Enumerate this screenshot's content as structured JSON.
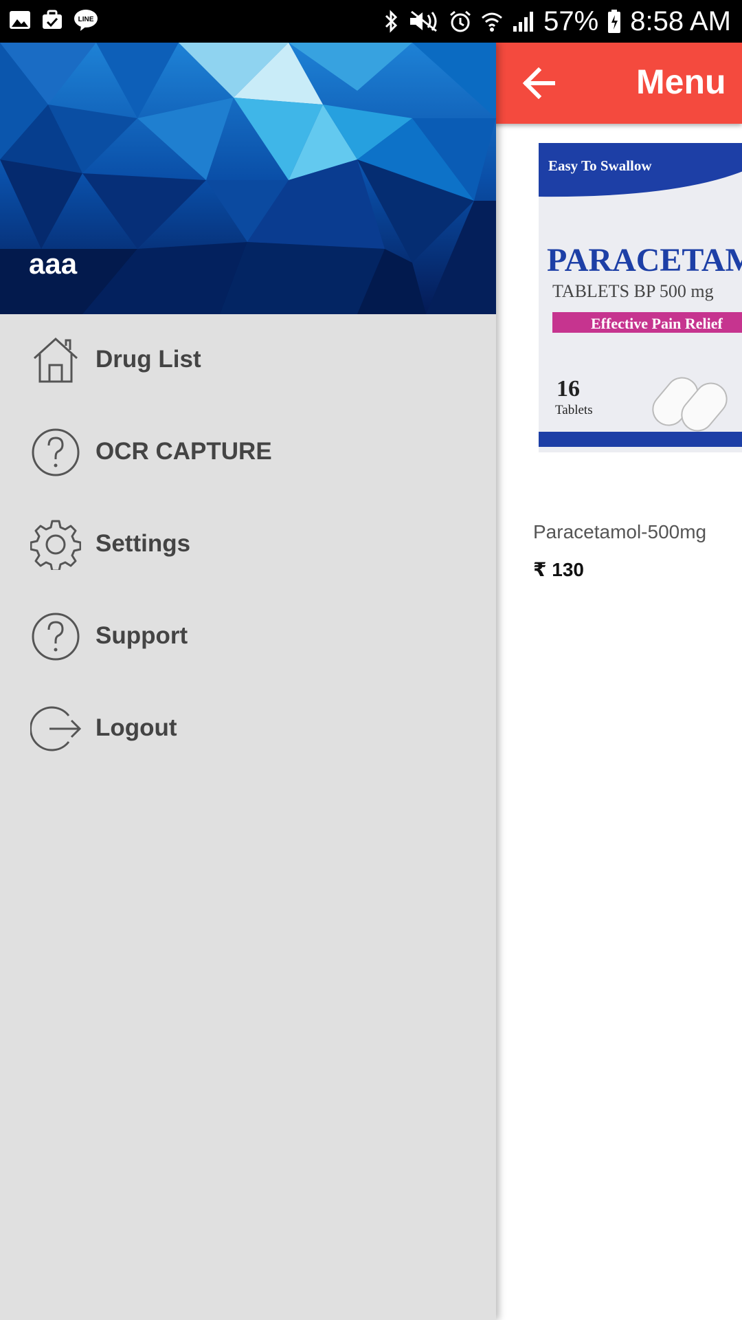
{
  "status_bar": {
    "battery": "57%",
    "time": "8:58 AM",
    "left_icons": [
      "image-icon",
      "briefcase-icon",
      "line-icon"
    ],
    "right_icons": [
      "bluetooth-icon",
      "mute-icon",
      "alarm-icon",
      "wifi-icon",
      "signal-icon",
      "battery-icon"
    ]
  },
  "app_bar": {
    "title": "Menu",
    "back_icon": "arrow-left-icon",
    "color": "#f44a3e"
  },
  "product": {
    "name": "Paracetamol-500mg",
    "price": "₹ 130",
    "image_texts": {
      "tagline": "Easy To Swallow",
      "brand": "PARACETAMO",
      "strength": "TABLETS BP 500 mg",
      "claim": "Effective Pain Relief",
      "count": "16",
      "count_unit": "Tablets"
    }
  },
  "drawer": {
    "user_name": "aaa",
    "items": [
      {
        "label": "Drug List",
        "icon": "home-icon"
      },
      {
        "label": "OCR CAPTURE",
        "icon": "help-circle-icon"
      },
      {
        "label": "Settings",
        "icon": "gear-icon"
      },
      {
        "label": "Support",
        "icon": "help-circle-icon"
      },
      {
        "label": "Logout",
        "icon": "logout-icon"
      }
    ]
  }
}
